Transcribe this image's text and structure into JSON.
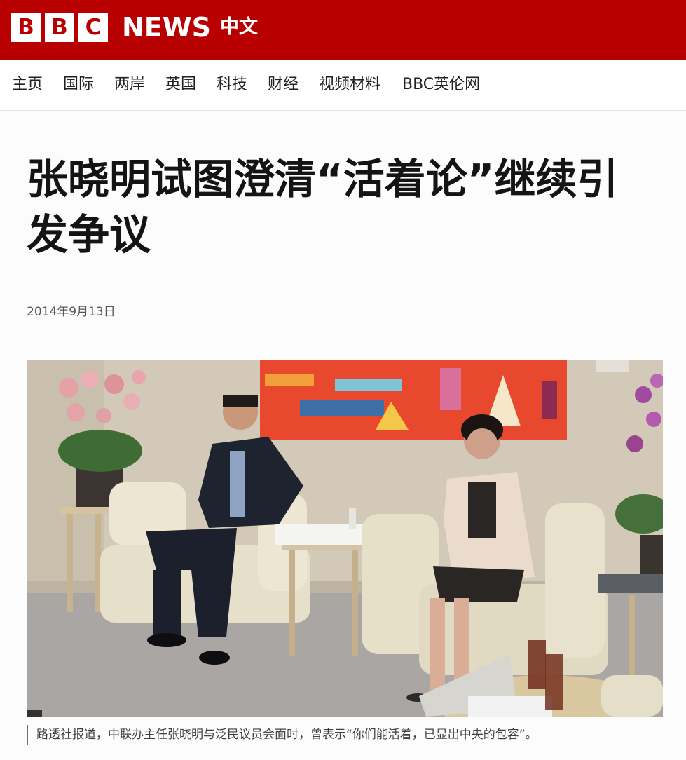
{
  "brand": {
    "letters": [
      "B",
      "B",
      "C"
    ],
    "news_word": "NEWS",
    "language_label": "中文",
    "colors": {
      "masthead": "#b80000",
      "logo_text": "#ffffff"
    }
  },
  "nav": {
    "items": [
      {
        "label": "主页"
      },
      {
        "label": "国际"
      },
      {
        "label": "两岸"
      },
      {
        "label": "英国"
      },
      {
        "label": "科技"
      },
      {
        "label": "财经"
      },
      {
        "label": "视频材料"
      },
      {
        "label": "BBC英伦网"
      }
    ]
  },
  "article": {
    "headline": "张晓明试图澄清“活着论”继续引发争议",
    "date": "2014年9月13日",
    "image": {
      "caption": "路透社报道，中联办主任张晓明与泛民议员会面时，曾表示“你们能活着，已显出中央的包容”。"
    }
  }
}
